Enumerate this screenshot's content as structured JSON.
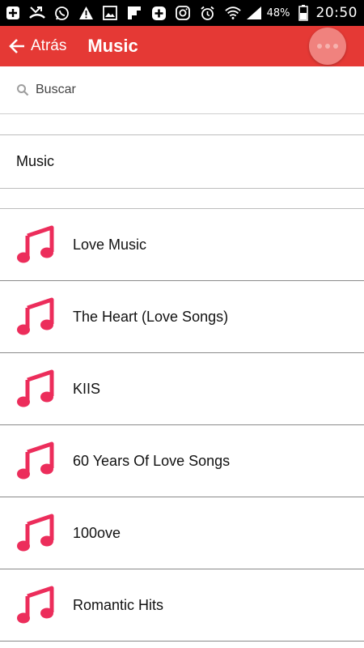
{
  "status_bar": {
    "battery": "48%",
    "time": "20:50"
  },
  "app_bar": {
    "back_label": "Atrás",
    "title": "Music"
  },
  "search": {
    "placeholder": "Buscar"
  },
  "section": {
    "title": "Music"
  },
  "items": [
    {
      "label": "Love Music"
    },
    {
      "label": "The Heart (Love Songs)"
    },
    {
      "label": "KIIS"
    },
    {
      "label": "60 Years Of Love Songs"
    },
    {
      "label": "100ove"
    },
    {
      "label": "Romantic Hits"
    }
  ],
  "colors": {
    "app_bar": "#e53935",
    "note_icon": "#ec2d5b"
  }
}
